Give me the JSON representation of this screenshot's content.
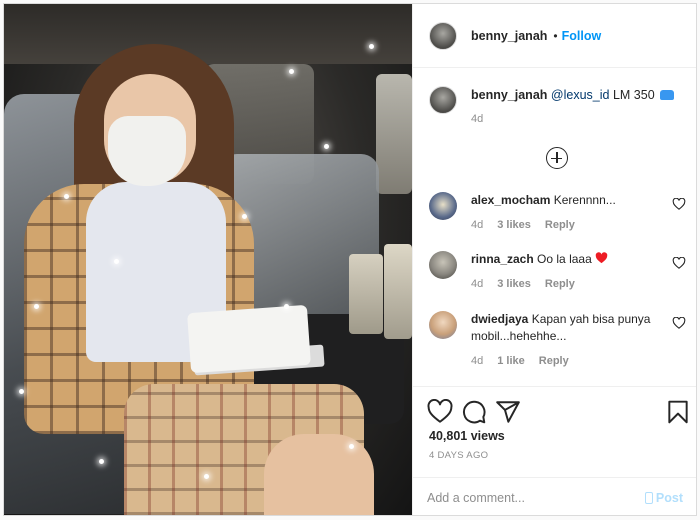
{
  "post": {
    "username": "benny_janah",
    "follow_label": "Follow",
    "separator": "•"
  },
  "caption": {
    "username": "benny_janah",
    "mention": "@lexus_id",
    "text": "LM 350",
    "emoji": "car-icon",
    "time": "4d"
  },
  "comments": [
    {
      "username": "alex_mocham",
      "text": "Kerennnn...",
      "time": "4d",
      "likes": "3 likes",
      "reply": "Reply",
      "avatar_color": "#5a6a8a"
    },
    {
      "username": "rinna_zach",
      "text": "Oo la laaa",
      "time": "4d",
      "likes": "3 likes",
      "reply": "Reply",
      "avatar_color": "#8a8780",
      "emoji": "red-heart-icon"
    },
    {
      "username": "dwiedjaya",
      "text": "Kapan yah bisa punya mobil...hehehhe...",
      "time": "4d",
      "likes": "1 like",
      "reply": "Reply",
      "avatar_color": "#c9a07a"
    }
  ],
  "stats": {
    "views": "40,801 views",
    "posted": "4 DAYS AGO"
  },
  "composer": {
    "placeholder": "Add a comment...",
    "post_label": "Post"
  },
  "colors": {
    "accent": "#0095f6",
    "muted": "#8e8e8e",
    "heart": "#ed4956"
  }
}
